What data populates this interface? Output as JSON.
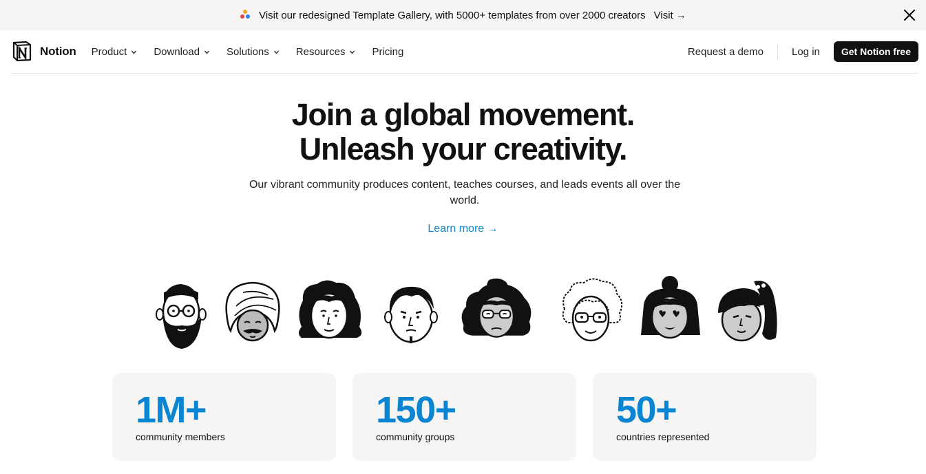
{
  "banner": {
    "icon": "template-gallery-icon",
    "message": "Visit our redesigned Template Gallery, with 5000+ templates from over 2000 creators",
    "visit_label": "Visit →",
    "close_icon": "close-icon"
  },
  "nav": {
    "brand": "Notion",
    "items": [
      {
        "label": "Product",
        "dropdown": true
      },
      {
        "label": "Download",
        "dropdown": true
      },
      {
        "label": "Solutions",
        "dropdown": true
      },
      {
        "label": "Resources",
        "dropdown": true
      },
      {
        "label": "Pricing",
        "dropdown": false
      }
    ],
    "request_demo": "Request a demo",
    "login": "Log in",
    "cta": "Get Notion free"
  },
  "hero": {
    "title_line1": "Join a global movement.",
    "title_line2": "Unleash your creativity.",
    "subtitle": "Our vibrant community produces content, teaches courses, and leads events all over the world.",
    "learn_more": "Learn more →"
  },
  "illustration": {
    "faces": [
      "bearded-man-face",
      "turban-man-face",
      "curly-hair-woman-face",
      "mustache-man-face",
      "beret-woman-face",
      "curly-glasses-person-face",
      "bun-woman-face",
      "ponytail-woman-face"
    ]
  },
  "stats": [
    {
      "value": "1M+",
      "label": "community members"
    },
    {
      "value": "150+",
      "label": "community groups"
    },
    {
      "value": "50+",
      "label": "countries represented"
    }
  ],
  "colors": {
    "accent_blue": "#0a85d1",
    "banner_bg": "#f6f5f4",
    "card_bg": "#f6f5f4",
    "cta_bg": "#111111"
  }
}
